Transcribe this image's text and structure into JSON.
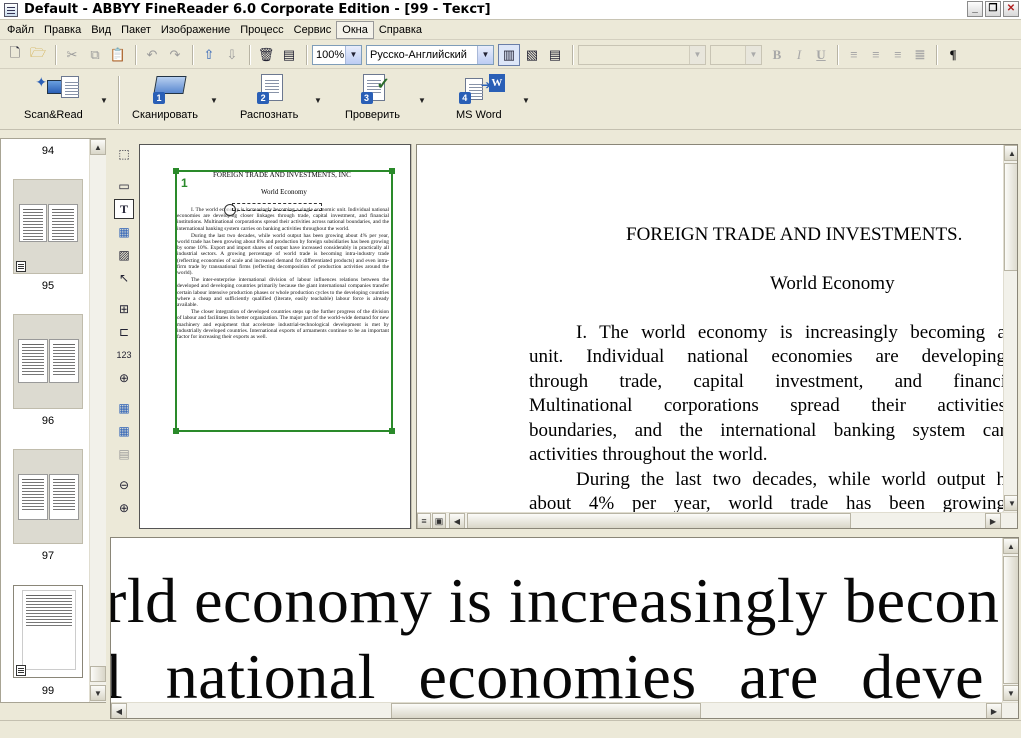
{
  "window": {
    "title": "Default - ABBYY FineReader 6.0 Corporate Edition - [99 - Текст]"
  },
  "menu": [
    "Файл",
    "Правка",
    "Вид",
    "Пакет",
    "Изображение",
    "Процесс",
    "Сервис",
    "Окна",
    "Справка"
  ],
  "menu_active_index": 7,
  "toolbar": {
    "zoom_value": "100%",
    "language_value": "Русско-Английский",
    "font_value": "",
    "size_value": "",
    "bold": "B",
    "italic": "I",
    "underline": "U",
    "paragraph": "¶"
  },
  "bigbar": {
    "scan_read": "Scan&Read",
    "scan": "Сканировать",
    "recognize": "Распознать",
    "check": "Проверить",
    "ms_word": "MS Word",
    "badges": [
      "1",
      "2",
      "3",
      "4"
    ],
    "word_badge": "W"
  },
  "thumbnails": {
    "labels": [
      "94",
      "95",
      "96",
      "97",
      "99"
    ]
  },
  "image_panel": {
    "block_number": "1",
    "header": "FOREIGN TRADE AND INVESTMENTS, INC",
    "subheader": "World Economy",
    "paragraphs": [
      "I. The world economy is increasingly becoming a single economic unit. Individual national economies are developing closer linkages through trade, capital investment, and financial institutions. Multinational corporations spread their activities across national boundaries, and the international banking system carries on banking activities throughout the world.",
      "During the last two decades, while world output has been growing about 4% per year, world trade has been growing about 8% and production by foreign subsidiaries has been growing by some 10%. Export and import shares of output have increased considerably in practically all industrial sectors. A growing percentage of world trade is becoming intra-industry trade (reflecting economies of scale and increased demand for differentiated products) and even intra-firm trade by transnational firms (reflecting decomposition of production activities around the world).",
      "The inter-enterprise international division of labour influences relations between the developed and developing countries primarily because the giant international companies transfer certain labour intensive production phases or whole production cycles to the developing countries where a cheap and sufficiently qualified (literate, easily teachable) labour force is already available.",
      "The closer integration of developed countries steps up the further progress of the division of labour and facilitates its better organization. The major part of the world-wide demand for new machinery and equipment that accelerate industrial-technological development is met by industrially developed countries. International exports of armaments continue to be an important factor for increasing their exports as well."
    ]
  },
  "text_panel": {
    "heading": "FOREIGN TRADE AND INVESTMENTS.",
    "subheading": "World Economy",
    "lines": [
      "I. The world economy is increasingly becoming a",
      "unit. Individual national economies are developing",
      "through trade, capital investment, and financi",
      "Multinational corporations spread their activities",
      "boundaries, and the international banking system car",
      "activities throughout the world.",
      "During the last two decades, while world output h",
      "about 4% per year, world trade has been growing"
    ]
  },
  "zoom_panel": {
    "line1": "rld economy is increasingly becon",
    "line2": "l national economies are deve"
  }
}
